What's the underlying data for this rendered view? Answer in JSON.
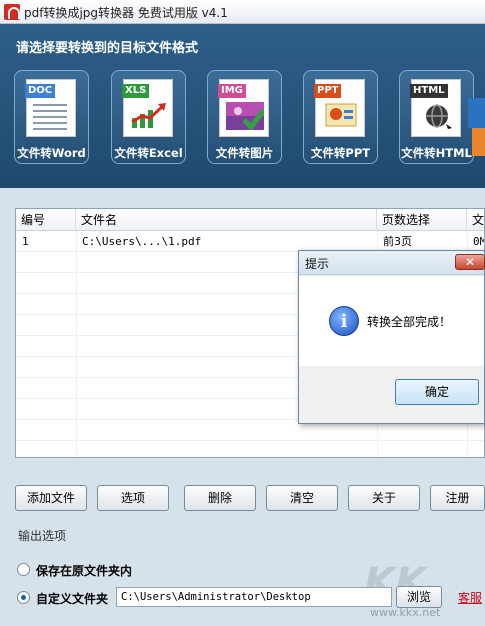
{
  "window": {
    "title": "pdf转换成jpg转换器 免费试用版 v4.1"
  },
  "header": {
    "heading": "请选择要转换到的目标文件格式",
    "formats": [
      {
        "tag": "DOC",
        "label": "文件转Word",
        "tag_color": "#3f7fd6"
      },
      {
        "tag": "XLS",
        "label": "文件转Excel",
        "tag_color": "#2e9a3c"
      },
      {
        "tag": "IMG",
        "label": "文件转图片",
        "tag_color": "#d04a94"
      },
      {
        "tag": "PPT",
        "label": "文件转PPT",
        "tag_color": "#d84d1a"
      },
      {
        "tag": "HTML",
        "label": "文件转HTML",
        "tag_color": "#333333"
      }
    ]
  },
  "table": {
    "columns": [
      "编号",
      "文件名",
      "页数选择",
      "文"
    ],
    "rows": [
      {
        "index": "1",
        "filename": "C:\\Users\\...\\1.pdf",
        "pages": "前3页",
        "status": "0M"
      }
    ]
  },
  "dialog": {
    "title": "提示",
    "close_label": "✕",
    "message": "转换全部完成！",
    "ok_label": "确定"
  },
  "buttons": [
    "添加文件",
    "选项",
    "删除",
    "清空",
    "关于",
    "注册"
  ],
  "output": {
    "section_title": "输出选项",
    "option_original": "保存在原文件夹内",
    "option_custom": "自定义文件夹",
    "path_value": "C:\\Users\\Administrator\\Desktop",
    "browse_label": "浏览",
    "link_label": "客服",
    "selected": "custom"
  },
  "watermark": {
    "text": "KK下载",
    "sub": "www.kkx.net"
  },
  "colors": {
    "header_bg": "#2d5f89",
    "panel_bg": "#d6e2ea",
    "link": "#d0021b"
  }
}
